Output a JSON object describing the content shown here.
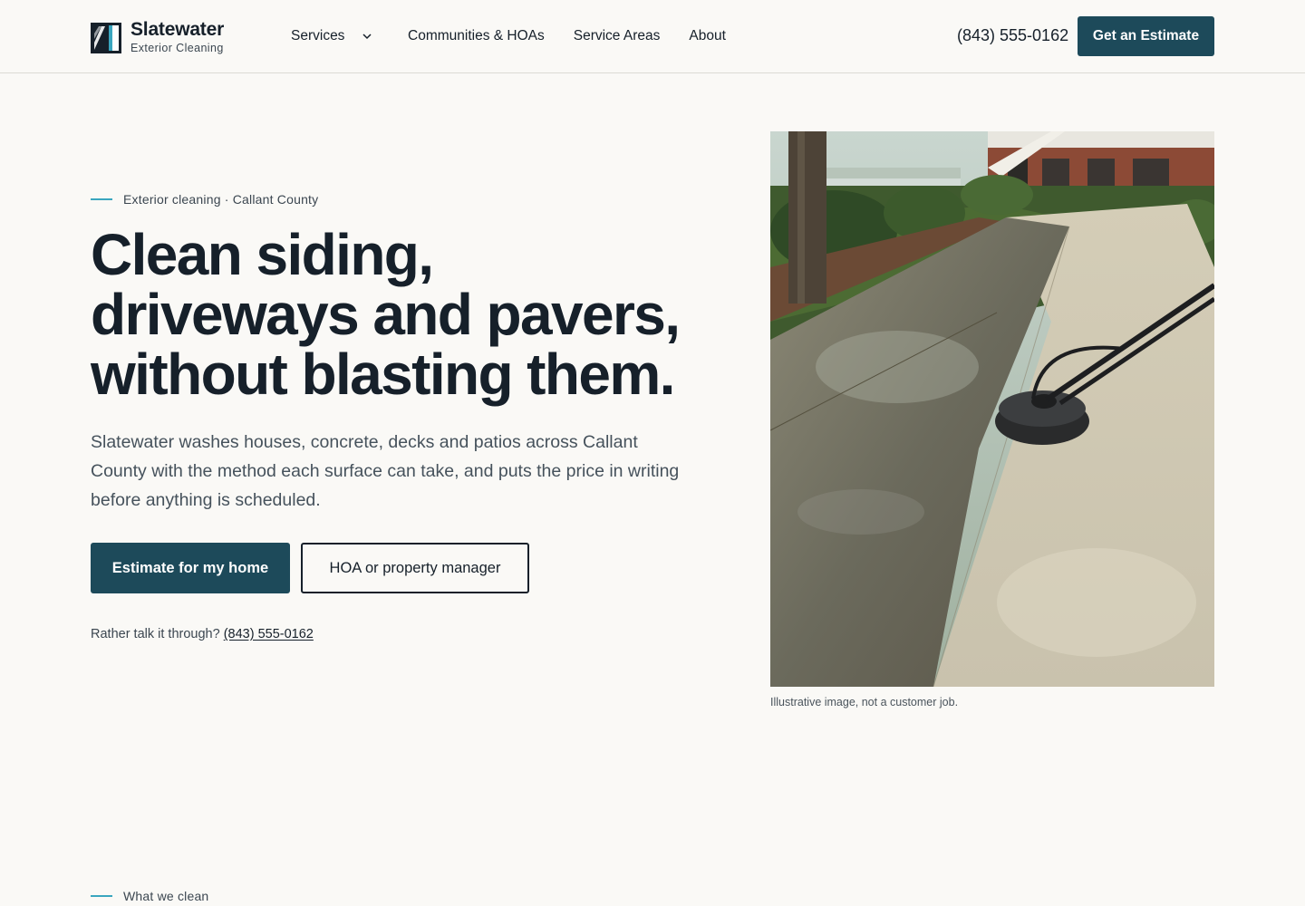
{
  "brand": {
    "name": "Slatewater",
    "tagline": "Exterior Cleaning"
  },
  "nav": {
    "items": [
      {
        "label": "Services",
        "has_dropdown": true
      },
      {
        "label": "Communities & HOAs"
      },
      {
        "label": "Service Areas"
      },
      {
        "label": "About"
      }
    ]
  },
  "header": {
    "phone": "(843) 555-0162",
    "cta_label": "Get an Estimate"
  },
  "hero": {
    "eyebrow": "Exterior cleaning · Callant County",
    "headline_lines": [
      "Clean siding,",
      "driveways and pavers,",
      "without blasting them."
    ],
    "lede": "Slatewater washes houses, concrete, decks and patios across Callant County with the method each surface can take, and puts the price in writing before anything is scheduled.",
    "primary_button": "Estimate for my home",
    "secondary_button": "HOA or property manager",
    "talk_prefix": "Rather talk it through?",
    "talk_phone": "(843) 555-0162",
    "image_caption": "Illustrative image, not a customer job."
  },
  "next_section": {
    "eyebrow": "What we clean"
  },
  "colors": {
    "background": "#faf9f6",
    "ink": "#16202a",
    "primary": "#1d4a5a",
    "accent_line": "#3aa6bf",
    "muted_text": "#46525c"
  },
  "icons": {
    "logo": "slatewater-logo-icon",
    "dropdown": "chevron-down-icon"
  }
}
